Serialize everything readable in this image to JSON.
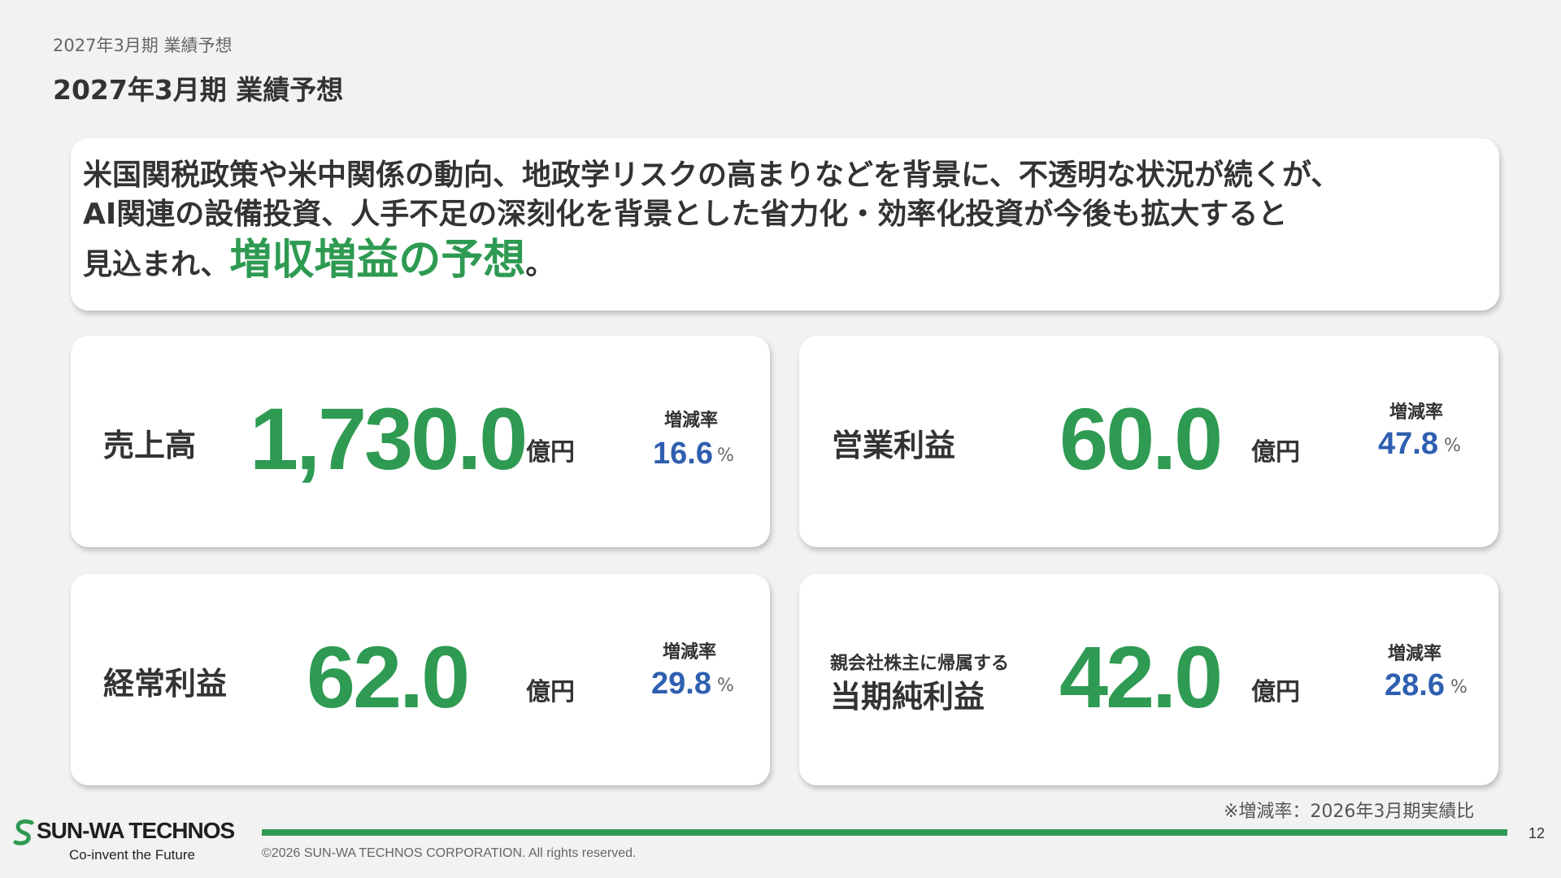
{
  "header": {
    "breadcrumb": "2027年3月期 業績予想",
    "title": "2027年3月期 業績予想"
  },
  "summary": {
    "line1": "米国関税政策や米中関係の動向、地政学リスクの高まりなどを背景に、不透明な状況が続くが、",
    "line2": "AI関連の設備投資、人手不足の深刻化を背景とした省力化・効率化投資が今後も拡大すると",
    "line3_prefix": "見込まれ、",
    "line3_highlight": "増収増益の予想",
    "line3_suffix": "。"
  },
  "metrics": [
    {
      "label": "売上高",
      "value": "1,730.0",
      "unit": "億円",
      "rate_label": "増減率",
      "rate": "16.6",
      "rate_unit": "%"
    },
    {
      "label": "営業利益",
      "value": "60.0",
      "unit": "億円",
      "rate_label": "増減率",
      "rate": "47.8",
      "rate_unit": "%"
    },
    {
      "label": "経常利益",
      "value": "62.0",
      "unit": "億円",
      "rate_label": "増減率",
      "rate": "29.8",
      "rate_unit": "%"
    },
    {
      "label_small": "親会社株主に帰属する",
      "label": "当期純利益",
      "value": "42.0",
      "unit": "億円",
      "rate_label": "増減率",
      "rate": "28.6",
      "rate_unit": "%"
    }
  ],
  "footer": {
    "footnote": "※増減率：2026年3月期実績比",
    "logo_name": "SUN-WA TECHNOS",
    "logo_tagline": "Co-invent the Future",
    "copyright": "©2026 SUN-WA TECHNOS CORPORATION. All rights reserved.",
    "page_number": "12"
  },
  "colors": {
    "accent_green": "#2e9a52",
    "rate_blue": "#2e5fb0",
    "background": "#f2f2f2"
  }
}
